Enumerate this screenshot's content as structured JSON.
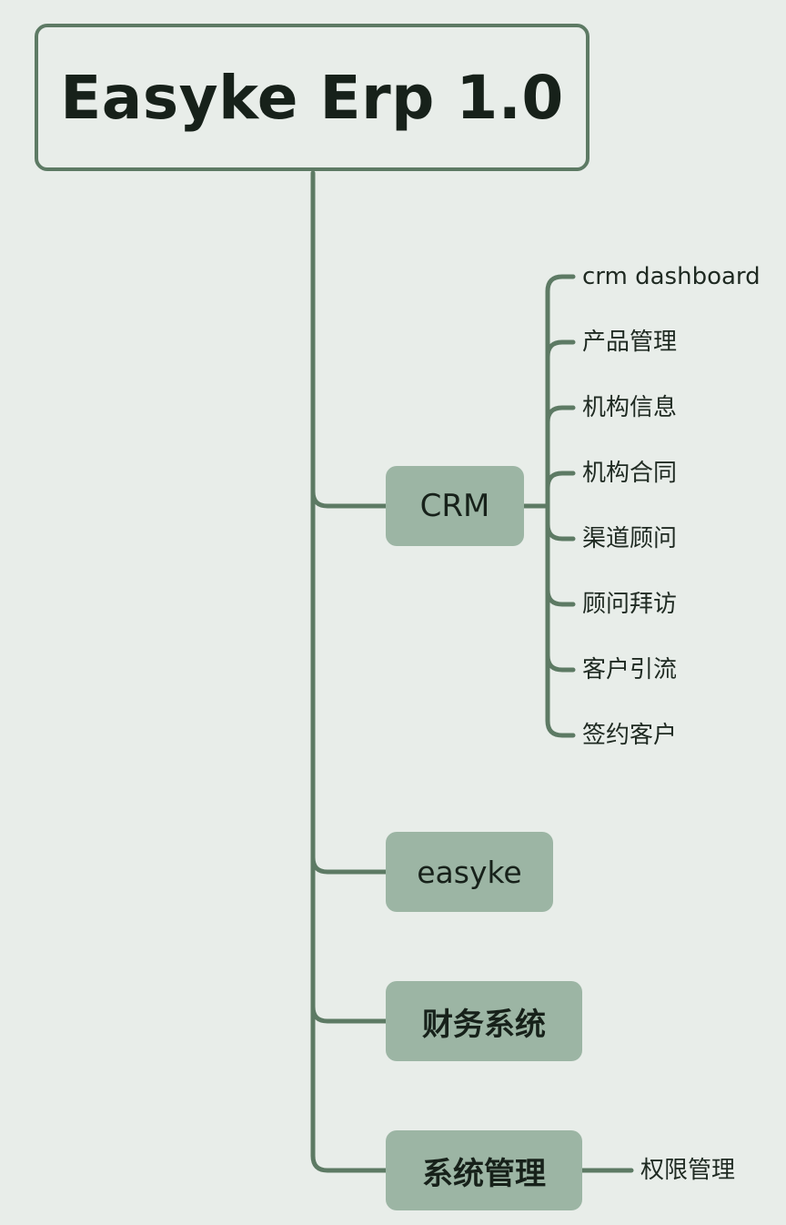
{
  "root": {
    "title": "Easyke Erp 1.0"
  },
  "branches": [
    {
      "label": "CRM"
    },
    {
      "label": "easyke"
    },
    {
      "label": "财务系统"
    },
    {
      "label": "系统管理"
    }
  ],
  "crm_children": [
    "crm dashboard",
    "产品管理",
    "机构信息",
    "机构合同",
    "渠道顾问",
    "顾问拜访",
    "客户引流",
    "签约客户"
  ],
  "system_children": [
    "权限管理"
  ],
  "colors": {
    "background": "#e8ede9",
    "connector": "#5d7a64",
    "branch_fill": "#9cb5a4",
    "text": "#17211a"
  }
}
